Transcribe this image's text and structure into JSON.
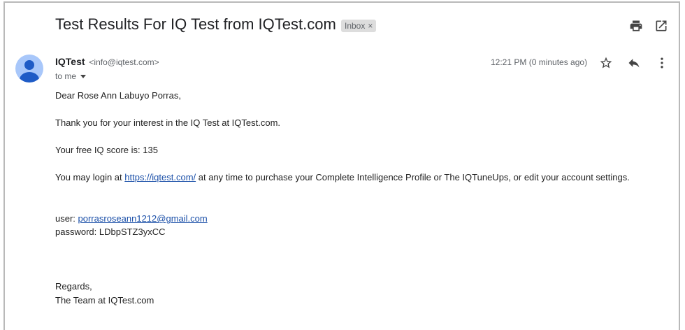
{
  "email": {
    "subject": "Test Results For IQ Test from IQTest.com",
    "label": "Inbox",
    "label_remove": "×",
    "sender_name": "IQTest",
    "sender_email": "<info@iqtest.com>",
    "recipient": "to me",
    "timestamp": "12:21 PM (0 minutes ago)",
    "body": {
      "greeting": "Dear Rose Ann Labuyo Porras,",
      "thanks": "Thank you for your interest in the IQ Test at IQTest.com.",
      "score": "Your free IQ score is: 135",
      "login_prefix": "You may login at ",
      "login_link": "https://iqtest.com/",
      "login_suffix": " at any time to purchase your Complete Intelligence Profile or The IQTuneUps, or edit your account settings.",
      "user_label": "user: ",
      "user_email": "porrasroseann1212@gmail.com",
      "password_line": "password: LDbpSTZ3yxCC",
      "regards": "Regards,",
      "signature": "The Team at IQTest.com"
    }
  },
  "icons": {
    "print": "print-icon",
    "open_new_window": "open-in-new-window-icon",
    "star": "star-icon",
    "reply": "reply-icon",
    "more": "more-vert-icon",
    "avatar": "person-avatar-icon"
  },
  "colors": {
    "link": "#1a4fa8",
    "avatar_bg": "#a8c7fa",
    "avatar_fg": "#1e5bc6",
    "chip_bg": "#dddddd"
  }
}
